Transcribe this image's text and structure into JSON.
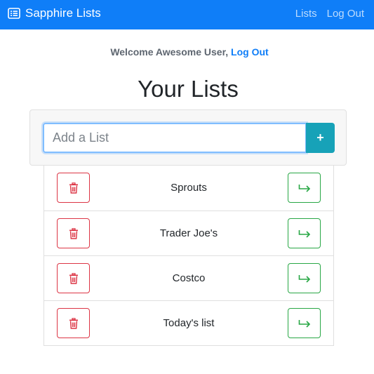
{
  "navbar": {
    "brand_label": "Sapphire Lists",
    "brand_icon": "list-alt-icon",
    "links": [
      {
        "label": "Lists"
      },
      {
        "label": "Log Out"
      }
    ],
    "background_color": "#0f7ef8"
  },
  "welcome": {
    "text": "Welcome Awesome User,",
    "logout_label": "Log Out"
  },
  "page_title": "Your Lists",
  "add_form": {
    "input_value": "",
    "input_placeholder": "Add a List",
    "add_button_label": "+",
    "add_button_color": "#17a2b8"
  },
  "lists": [
    {
      "name": "Sprouts",
      "delete_icon": "trash-icon",
      "open_icon": "arrow-right-icon"
    },
    {
      "name": "Trader Joe's",
      "delete_icon": "trash-icon",
      "open_icon": "arrow-right-icon"
    },
    {
      "name": "Costco",
      "delete_icon": "trash-icon",
      "open_icon": "arrow-right-icon"
    },
    {
      "name": "Today's list",
      "delete_icon": "trash-icon",
      "open_icon": "arrow-right-icon"
    }
  ],
  "colors": {
    "danger": "#dc3545",
    "success": "#28a745"
  }
}
